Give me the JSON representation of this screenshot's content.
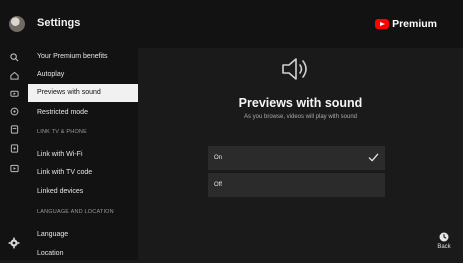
{
  "header": {
    "title": "Settings",
    "brand": "Premium",
    "avatar_icon": "avatar",
    "brand_logo_color": "#ff0000"
  },
  "rail": {
    "icons": [
      "search-icon",
      "home-icon",
      "subscriptions-icon",
      "library-icon",
      "history-icon",
      "movies-icon",
      "downloads-icon"
    ],
    "settings_icon": "gear-icon"
  },
  "sidebar": {
    "items": [
      {
        "label": "Your Premium benefits",
        "selected": false
      },
      {
        "label": "Autoplay",
        "selected": false
      },
      {
        "label": "Previews with sound",
        "selected": true
      },
      {
        "label": "Restricted mode",
        "selected": false
      },
      {
        "label": "Link with Wi-Fi",
        "selected": false
      },
      {
        "label": "Link with TV code",
        "selected": false
      },
      {
        "label": "Linked devices",
        "selected": false
      },
      {
        "label": "Language",
        "selected": false
      },
      {
        "label": "Location",
        "selected": false
      }
    ],
    "sections": [
      "LINK TV & PHONE",
      "LANGUAGE AND LOCATION"
    ]
  },
  "main": {
    "icon": "speaker-icon",
    "heading": "Previews with sound",
    "subtitle": "As you browse, videos will play with sound",
    "options": [
      {
        "label": "On",
        "selected": true
      },
      {
        "label": "Off",
        "selected": false
      }
    ]
  },
  "footer": {
    "back_label": "Back",
    "back_icon": "back-icon"
  }
}
